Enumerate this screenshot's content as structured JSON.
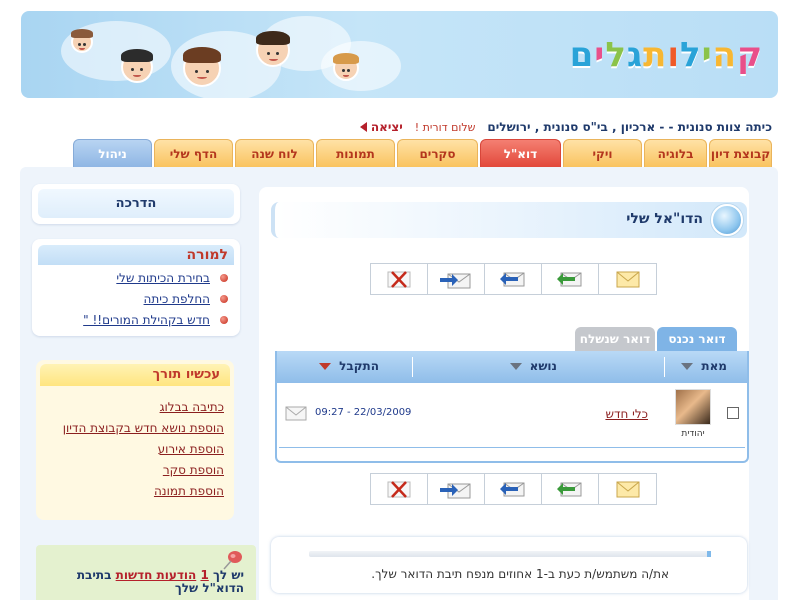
{
  "header": {
    "logo_text": "קהילות גלים",
    "logo_letters": [
      "ק",
      "ה",
      "י",
      "ל",
      "ו",
      "ת",
      "ג",
      "ל",
      "י",
      "ם"
    ],
    "logo_colors": [
      "#e94f8a",
      "#f7b733",
      "#8bc34a",
      "#29a3d8",
      "#f05a28",
      "#f7b733",
      "#29a3d8",
      "#8bc34a",
      "#e94f8a",
      "#29a3d8"
    ]
  },
  "info": {
    "class_name": "כיתה צוות סנונית - - ארכיון , בי\"ס סנונית , ירושלים",
    "greeting": "שלום דורית !",
    "logout": "יציאה"
  },
  "tabs": [
    {
      "label": "קבוצת דיון",
      "state": "normal"
    },
    {
      "label": "בלוגיה",
      "state": "normal"
    },
    {
      "label": "ויקי",
      "state": "normal"
    },
    {
      "label": "דוא\"ל",
      "state": "active"
    },
    {
      "label": "סקרים",
      "state": "normal"
    },
    {
      "label": "תמונות",
      "state": "normal"
    },
    {
      "label": "לוח שנה",
      "state": "normal"
    },
    {
      "label": "הדף שלי",
      "state": "normal"
    },
    {
      "label": "ניהול",
      "state": "admin"
    }
  ],
  "sidebar": {
    "guide_label": "הדרכה",
    "teacher_title": "למורה",
    "teacher_links": [
      "בחירת הכיתות שלי",
      "החלפת כיתה",
      "חדש בקהילת המורים!! \""
    ],
    "now_title": "עכשיו תורך",
    "now_links": [
      "כתיבה בבלוג",
      "הוספת נושא חדש בקבוצת הדיון",
      "הוספת אירוע",
      "הוספת סקר",
      "הוספת תמונה"
    ],
    "message": {
      "prefix": "יש לך",
      "count": "1",
      "new_text": "הודעות חדשות",
      "suffix": "בתיבת הדוא\"ל שלך"
    }
  },
  "mail": {
    "title": "הדו\"אל שלי",
    "toolbar_actions": [
      "new-message",
      "reply",
      "reply-all",
      "forward",
      "delete"
    ],
    "inbox_tabs": [
      {
        "label": "דואר נכנס",
        "active": true
      },
      {
        "label": "דואר שנשלח",
        "active": false
      }
    ],
    "columns": {
      "from": "מאת",
      "subject": "נושא",
      "received": "התקבל"
    },
    "rows": [
      {
        "sender_name": "יהודית",
        "subject": "כלי חדש",
        "datetime": "09:27 - 22/03/2009"
      }
    ],
    "quota_percent": 1,
    "quota_text": "את/ה משתמש/ת כעת ב-1 אחוזים מנפח תיבת הדואר שלך."
  },
  "colors": {
    "accent_blue": "#7fb4e6",
    "tab_orange": "#f9c35f",
    "tab_active_red": "#e2483a",
    "link_red": "#8b1f1f"
  }
}
